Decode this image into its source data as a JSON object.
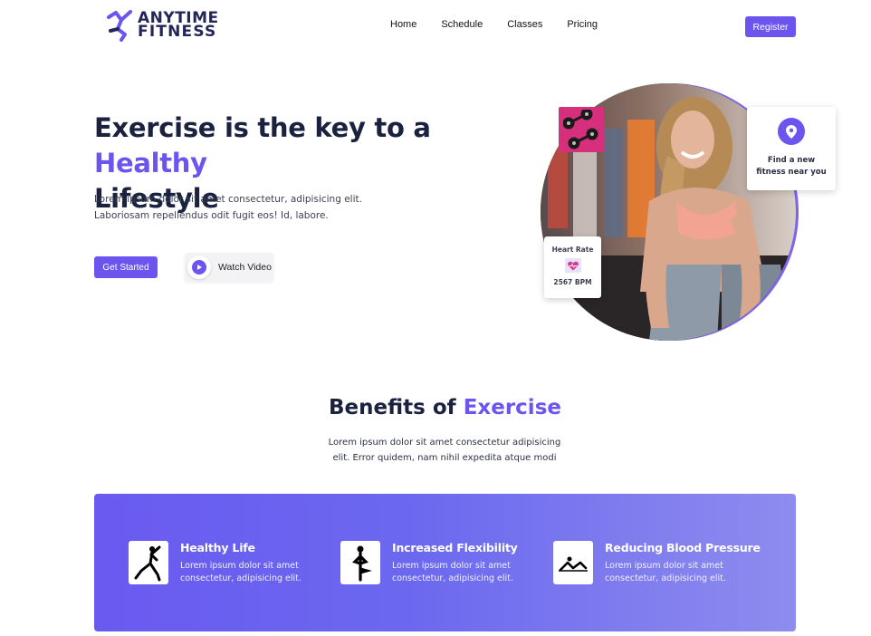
{
  "header": {
    "logo_line1": "ANYTIME",
    "logo_line2": "FITNESS",
    "nav": [
      "Home",
      "Schedule",
      "Classes",
      "Pricing"
    ],
    "register_label": "Register"
  },
  "hero": {
    "title_part1": "Exercise is the key to a ",
    "title_accent": "Healthy",
    "title_part2": "Lifestyle",
    "desc_line1": "Lorem ipsum dolor sit amet consectetur, adipisicing elit.",
    "desc_line2": "Laboriosam repellendus odit fugit eos! Id, labore.",
    "get_started_label": "Get Started",
    "watch_video_label": "Watch Video",
    "find_card_line1": "Find a new",
    "find_card_line2": "fitness near you",
    "heart_title": "Heart Rate",
    "heart_bpm": "2567 BPM"
  },
  "benefits": {
    "title_part1": "Benefits of ",
    "title_accent": "Exercise",
    "desc_line1": "Lorem ipsum dolor sit amet consectetur adipisicing",
    "desc_line2": "elit. Error quidem, nam nihil expedita atque modi",
    "items": [
      {
        "title": "Healthy Life",
        "desc_line1": "Lorem ipsum dolor sit amet",
        "desc_line2": "consectetur, adipisicing elit.",
        "icon": "yoga-pose-icon"
      },
      {
        "title": "Increased Flexibility",
        "desc_line1": "Lorem ipsum dolor sit amet",
        "desc_line2": "consectetur, adipisicing elit.",
        "icon": "tree-pose-icon"
      },
      {
        "title": "Reducing Blood Pressure",
        "desc_line1": "Lorem ipsum dolor sit amet",
        "desc_line2": "consectetur, adipisicing elit.",
        "icon": "floor-stretch-icon"
      }
    ]
  },
  "colors": {
    "accent": "#6c54ef",
    "heading": "#1a2240",
    "dumbbell_card": "#d62f7c"
  }
}
